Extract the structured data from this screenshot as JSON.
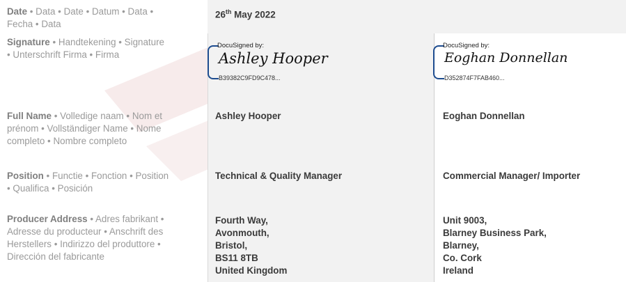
{
  "left_labels": {
    "date": {
      "title": "Date",
      "rest": [
        " • Data • Date • Datum • Data •",
        "Fecha • Data"
      ]
    },
    "signature": {
      "title": "Signature",
      "rest": [
        " • Handtekening • Signature",
        "• Unterschrift Firma • Firma"
      ]
    },
    "full_name": {
      "title": "Full Name",
      "rest": [
        " • Volledige naam • Nom et",
        "prénom • Vollständiger Name • Nome",
        "completo • Nombre completo"
      ]
    },
    "position": {
      "title": "Position",
      "rest": [
        " • Functie • Fonction • Position",
        "• Qualifica • Posición"
      ]
    },
    "producer_address": {
      "title": "Producer Address",
      "rest": [
        " • Adres fabrikant •",
        "Adresse du producteur • Anschrift des",
        "Herstellers • Indirizzo del produttore •",
        "Dirección del fabricante"
      ]
    }
  },
  "date_value": {
    "day": "26",
    "suffix": "th",
    "rest": " May 2022"
  },
  "signers": [
    {
      "docusign_label": "DocuSigned by:",
      "signature": "Ashley Hooper",
      "envelope_id": "B39382C9FD9C478...",
      "full_name": "Ashley Hooper",
      "position": "Technical & Quality Manager",
      "address": [
        "Fourth Way,",
        "Avonmouth,",
        "Bristol,",
        "BS11 8TB",
        "United Kingdom"
      ]
    },
    {
      "docusign_label": "DocuSigned by:",
      "signature": "Eoghan Donnellan",
      "envelope_id": "D352874F7FAB460...",
      "full_name": "Eoghan Donnellan",
      "position": "Commercial Manager/ Importer",
      "address": [
        "Unit 9003,",
        "Blarney Business Park,",
        "Blarney,",
        "Co. Cork",
        "Ireland"
      ]
    }
  ],
  "colors": {
    "cell_bg": "#f2f2f2",
    "label_grey": "#9a9a9a",
    "value_text": "#3a3a3a",
    "docusign_blue": "#1d4c8f",
    "watermark": "#f3e3e3"
  }
}
